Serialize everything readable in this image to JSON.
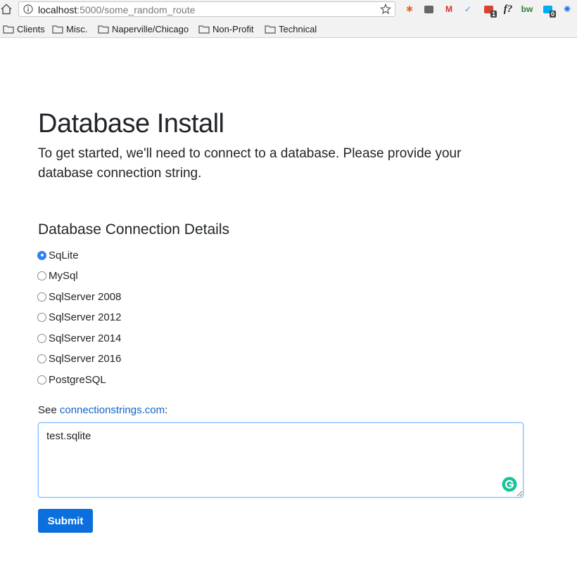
{
  "browser": {
    "url_host": "localhost",
    "url_rest": ":5000/some_random_route",
    "extensions": [
      {
        "name": "orange-asterisk-extension-icon",
        "glyph": "✱",
        "color": "#f26522"
      },
      {
        "name": "camera-extension-icon",
        "glyph": "",
        "color": "#666666"
      },
      {
        "name": "gmail-extension-icon",
        "glyph": "M",
        "color": "#d93025"
      },
      {
        "name": "check-extension-icon",
        "glyph": "✓",
        "color": "#4a90e2"
      },
      {
        "name": "todoist-extension-icon",
        "glyph": "",
        "color": "#db4035",
        "badge": "1"
      },
      {
        "name": "formula-extension-icon",
        "glyph": "f?",
        "color": "#222222"
      },
      {
        "name": "bw-extension-icon",
        "glyph": "bw",
        "color": "#2e7d32"
      },
      {
        "name": "ghostery-extension-icon",
        "glyph": "",
        "color": "#00aef0",
        "badge": "0"
      },
      {
        "name": "settings-extension-icon",
        "glyph": "✺",
        "color": "#1a73e8"
      }
    ]
  },
  "bookmarks": [
    "Clients",
    "Misc.",
    "Naperville/Chicago",
    "Non-Profit",
    "Technical"
  ],
  "page": {
    "title": "Database Install",
    "lead": "To get started, we'll need to connect to a database. Please provide your database connection string.",
    "section_title": "Database Connection Details",
    "db_options": [
      {
        "label": "SqLite",
        "checked": true
      },
      {
        "label": "MySql",
        "checked": false
      },
      {
        "label": "SqlServer 2008",
        "checked": false
      },
      {
        "label": "SqlServer 2012",
        "checked": false
      },
      {
        "label": "SqlServer 2014",
        "checked": false
      },
      {
        "label": "SqlServer 2016",
        "checked": false
      },
      {
        "label": "PostgreSQL",
        "checked": false
      }
    ],
    "see_prefix": "See ",
    "see_link": "connectionstrings.com",
    "see_suffix": ":",
    "connection_string": "test.sqlite",
    "submit_label": "Submit",
    "accent_color": "#0b6fdd"
  }
}
